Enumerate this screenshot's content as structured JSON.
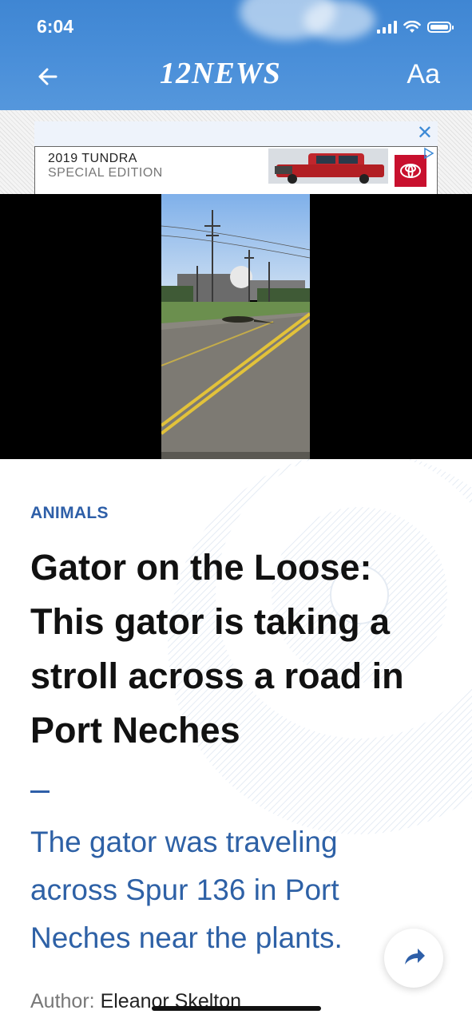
{
  "status_bar": {
    "time": "6:04"
  },
  "header": {
    "back_icon": "arrow-left-icon",
    "logo_text": "12NEWS",
    "text_size_label": "Aa"
  },
  "ad": {
    "line1": "2019 TUNDRA",
    "line2": "SPECIAL EDITION",
    "line3": "",
    "brand": "TOYOTA"
  },
  "article": {
    "category": "ANIMALS",
    "headline": "Gator on the Loose: This gator is taking a stroll across a road in Port Neches",
    "subheadline": "The gator was traveling across Spur 136 in Port Neches near the plants.",
    "author_label": "Author:",
    "author_name": "Eleanor Skelton"
  },
  "colors": {
    "header_blue": "#4a8fd9",
    "category_blue": "#2e5fa8",
    "subhead_blue": "#2e61a6",
    "headline": "#111111"
  }
}
